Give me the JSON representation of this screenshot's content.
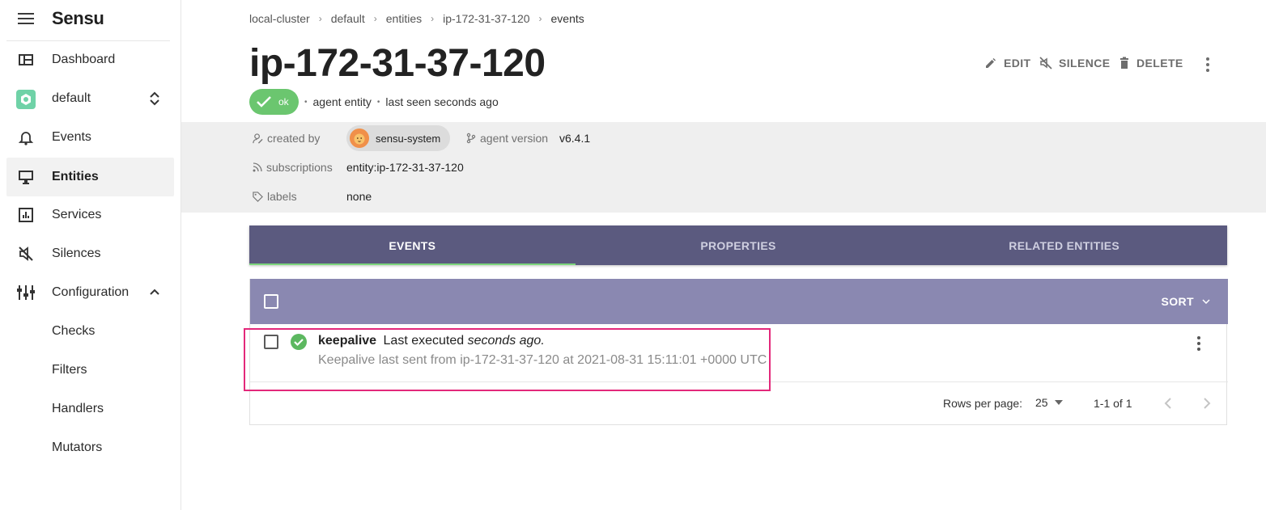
{
  "app": {
    "name": "Sensu"
  },
  "sidebar": {
    "items": [
      {
        "label": "Dashboard",
        "icon": "dashboard-icon"
      },
      {
        "label": "default",
        "icon": "namespace-icon"
      },
      {
        "label": "Events",
        "icon": "bell-icon"
      },
      {
        "label": "Entities",
        "icon": "monitor-icon",
        "active": true
      },
      {
        "label": "Services",
        "icon": "chart-icon"
      },
      {
        "label": "Silences",
        "icon": "silence-icon"
      },
      {
        "label": "Configuration",
        "icon": "sliders-icon"
      },
      {
        "label": "Checks"
      },
      {
        "label": "Filters"
      },
      {
        "label": "Handlers"
      },
      {
        "label": "Mutators"
      }
    ]
  },
  "breadcrumb": [
    "local-cluster",
    "default",
    "entities",
    "ip-172-31-37-120",
    "events"
  ],
  "entity": {
    "title": "ip-172-31-37-120",
    "status": "ok",
    "class": "agent entity",
    "last_seen": "last seen seconds ago"
  },
  "actions": {
    "edit": "EDIT",
    "silence": "SILENCE",
    "delete": "DELETE"
  },
  "meta": {
    "created_by_label": "created by",
    "created_by_value": "sensu-system",
    "agent_version_label": "agent version",
    "agent_version_value": "v6.4.1",
    "subscriptions_label": "subscriptions",
    "subscriptions_value": "entity:ip-172-31-37-120",
    "labels_label": "labels",
    "labels_value": "none"
  },
  "tabs": [
    "EVENTS",
    "PROPERTIES",
    "RELATED ENTITIES"
  ],
  "list": {
    "sort_label": "SORT",
    "rows": [
      {
        "check": "keepalive",
        "summary_prefix": "Last executed",
        "summary_em": "seconds ago.",
        "output": "Keepalive last sent from ip-172-31-37-120 at 2021-08-31 15:11:01 +0000 UTC"
      }
    ]
  },
  "pagination": {
    "rows_per_page_label": "Rows per page:",
    "rows_per_page": "25",
    "range": "1-1 of 1"
  },
  "colors": {
    "tab_bar": "#5b5a7f",
    "list_header": "#8a88b1",
    "ok_green": "#6bc66f",
    "highlight": "#e3287a"
  }
}
